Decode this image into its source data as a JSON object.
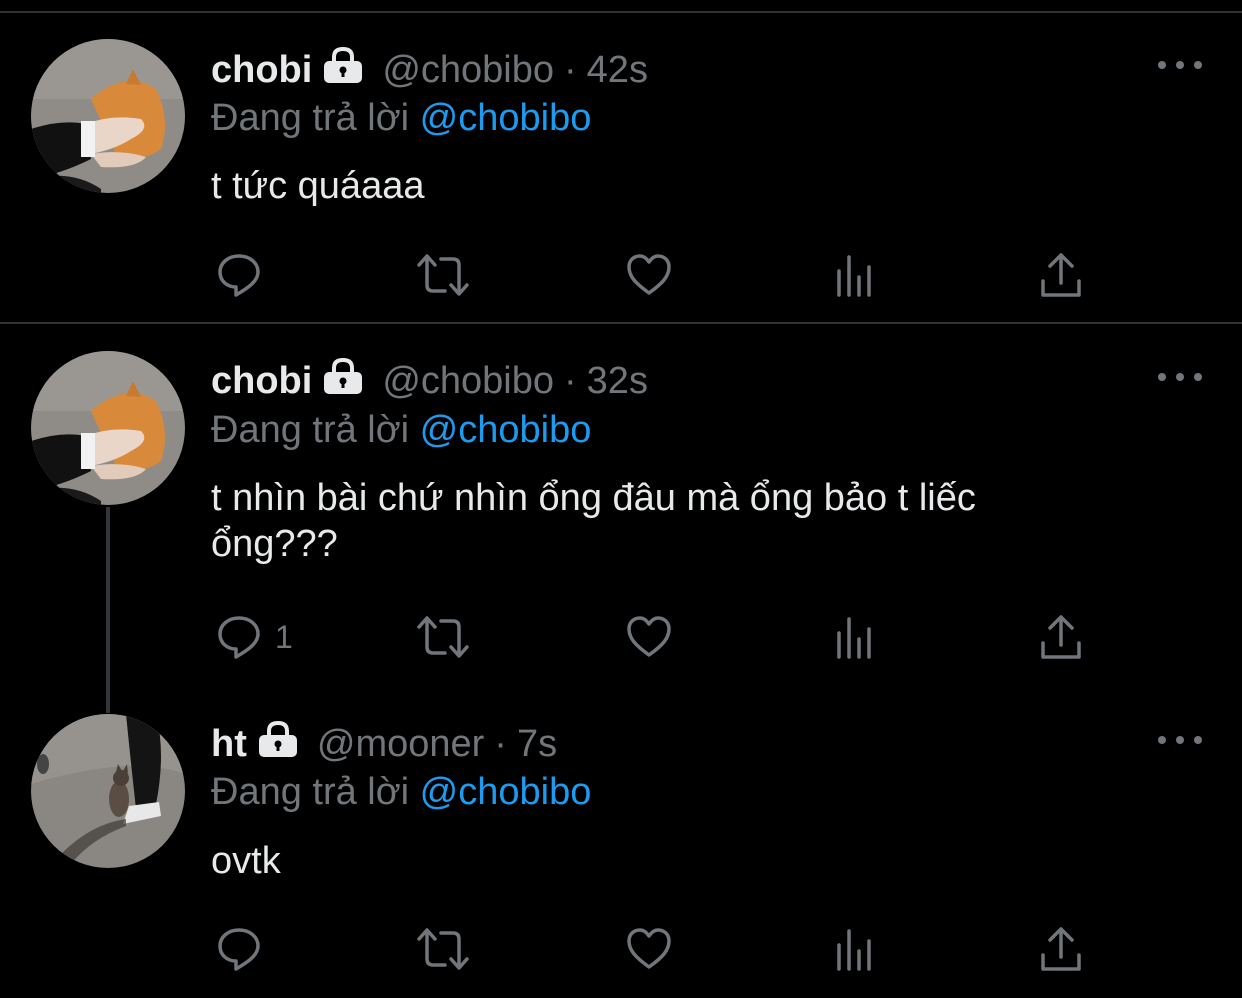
{
  "tweets": [
    {
      "name": "chobi",
      "handle": "@chobibo",
      "separator": "·",
      "time": "42s",
      "reply_prefix": "Đang trả lời",
      "reply_to": "@chobibo",
      "text": "t tức quáaaa",
      "reply_count": "",
      "avatar": "avatar-hand-petting-cat"
    },
    {
      "name": "chobi",
      "handle": "@chobibo",
      "separator": "·",
      "time": "32s",
      "reply_prefix": "Đang trả lời",
      "reply_to": "@chobibo",
      "text": "t nhìn bài chứ nhìn ổng đâu mà ổng bảo t liếc ổng???",
      "reply_count": "1",
      "avatar": "avatar-hand-petting-cat"
    },
    {
      "name": "ht",
      "handle": "@mooner",
      "separator": "·",
      "time": "7s",
      "reply_prefix": "Đang trả lời",
      "reply_to": "@chobibo",
      "text": "ovtk",
      "reply_count": "",
      "avatar": "avatar-cat-on-street"
    }
  ],
  "icons": {
    "lock": "lock-icon",
    "more": "more-icon",
    "reply": "reply-icon",
    "retweet": "retweet-icon",
    "like": "heart-icon",
    "views": "views-icon",
    "share": "share-icon"
  },
  "colors": {
    "background": "#000000",
    "text": "#e7e9ea",
    "secondary": "#71767b",
    "mention": "#1d9bf0",
    "divider": "#2f3336"
  }
}
